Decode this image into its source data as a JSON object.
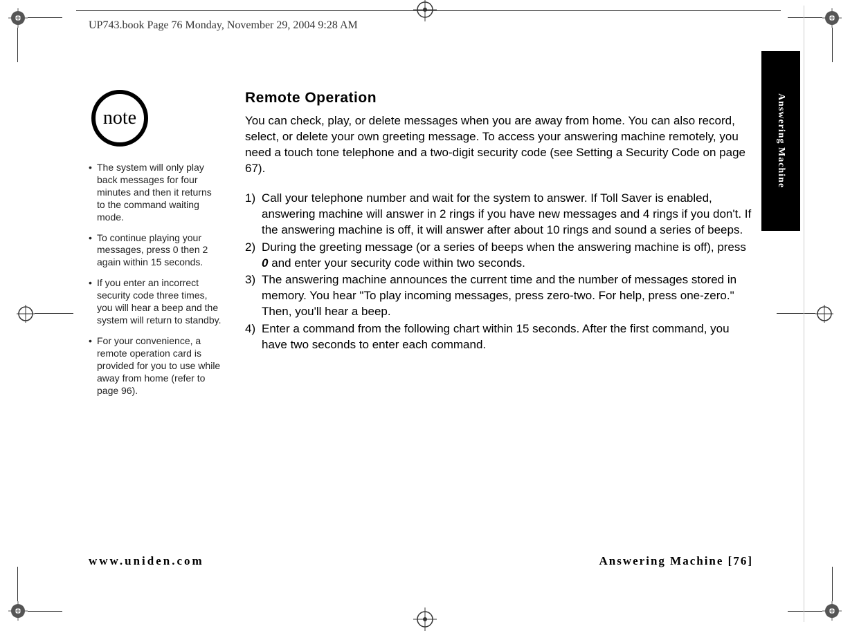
{
  "header": {
    "running": "UP743.book  Page 76  Monday, November 29, 2004  9:28 AM"
  },
  "side_tab": {
    "label": "Answering Machine"
  },
  "note": {
    "badge": "note",
    "items": [
      "The system will only play back messages for four minutes and then it returns to the command waiting mode.",
      "To continue playing your messages, press 0 then 2 again within 15 seconds.",
      "If you enter an incorrect security code three times, you will hear a beep and the system will return to standby.",
      "For your convenience, a remote operation card is provided for you to use while away from home (refer to page 96)."
    ]
  },
  "main": {
    "title": "Remote Operation",
    "intro": "You can check, play, or delete messages when you are away from home. You can also record, select, or delete your own greeting message. To access your answering machine remotely, you need a touch tone telephone and a two-digit security code (see Setting a Security Code on page 67).",
    "steps": [
      {
        "n": "1)",
        "t": "Call your telephone number and wait for the system to answer. If Toll Saver is enabled, answering machine will answer in 2 rings if you have new messages and 4 rings if you don't. If the answering machine is off, it will answer after about 10 rings and sound a series of beeps."
      },
      {
        "n": "2)",
        "pre": "During the greeting message (or a series of beeps when the answering machine is off), press ",
        "key": "0",
        "post": " and enter your security code within two seconds."
      },
      {
        "n": "3)",
        "t": "The answering machine announces the current time and the number of messages stored in memory. You hear \"To play incoming messages, press zero-two. For help, press one-zero.\" Then, you'll hear a beep."
      },
      {
        "n": "4)",
        "t": "Enter a command from the following chart within 15 seconds. After the first command, you have two seconds to enter each command."
      }
    ]
  },
  "footer": {
    "url": "www.uniden.com",
    "section": "Answering Machine",
    "page": "[76]"
  }
}
